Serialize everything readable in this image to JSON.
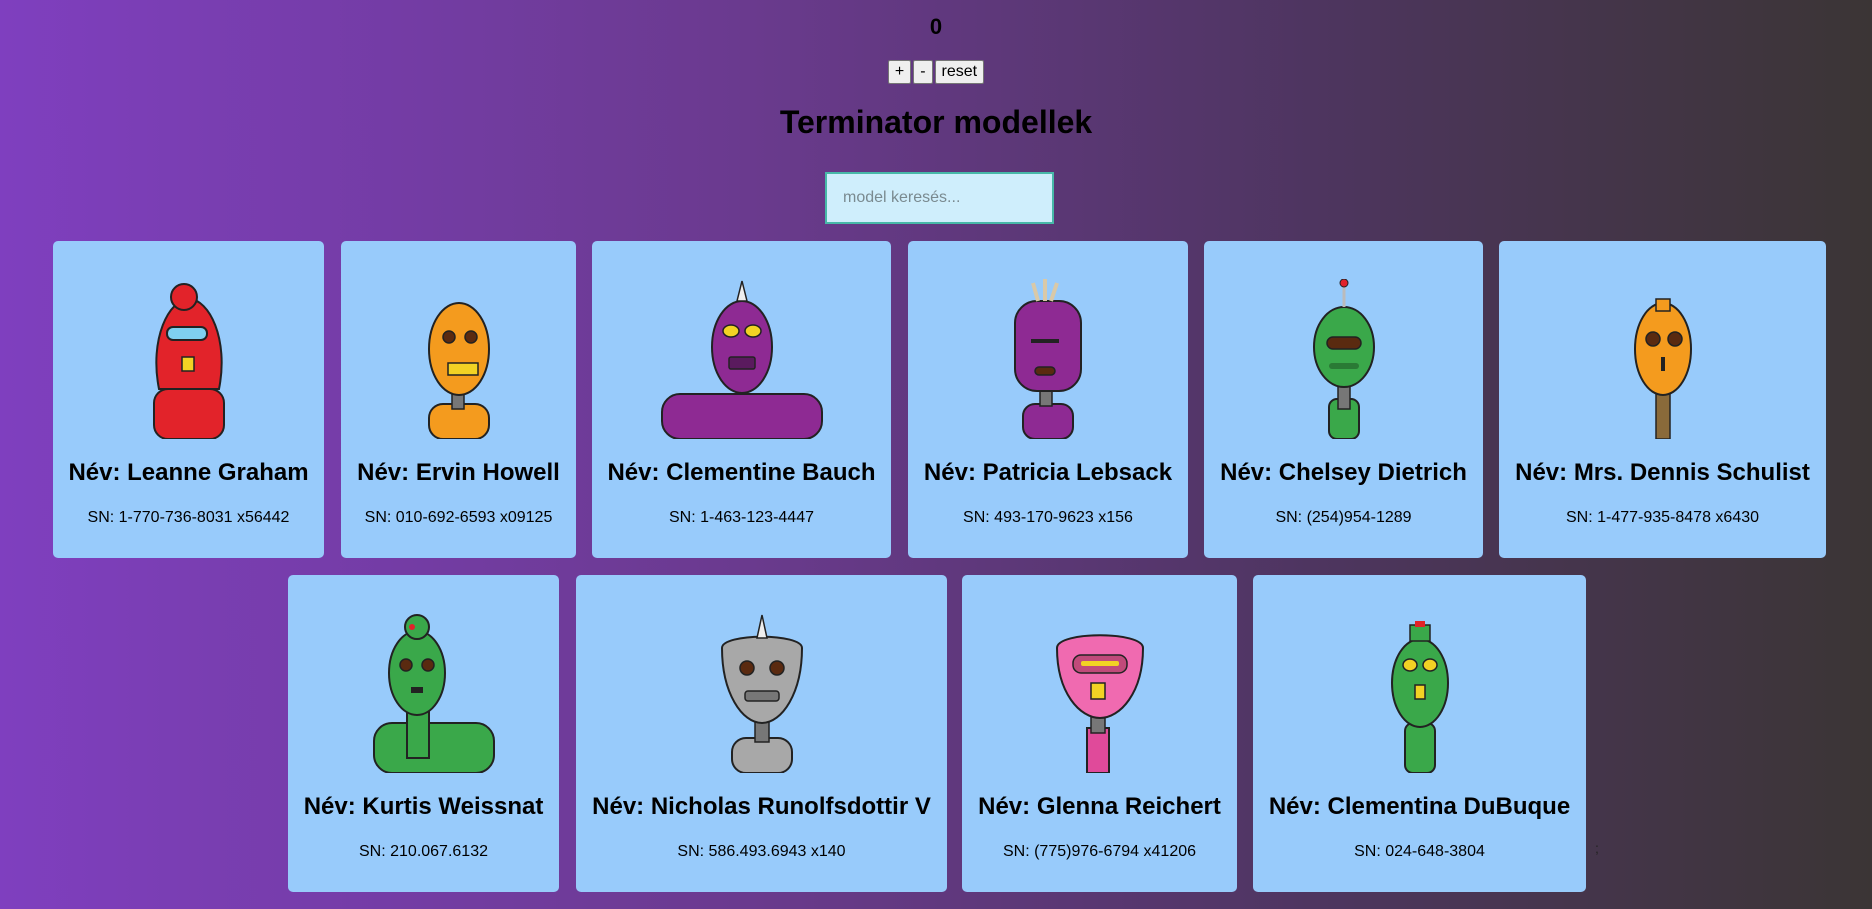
{
  "counter": {
    "value": "0"
  },
  "controls": {
    "plus_label": "+",
    "minus_label": "-",
    "reset_label": "reset"
  },
  "page": {
    "title": "Terminator modellek"
  },
  "search": {
    "placeholder": "model keresés...",
    "value": ""
  },
  "robots": [
    {
      "name": "Név: Leanne Graham",
      "sn": "SN: 1-770-736-8031 x56442",
      "color": "#e2232a"
    },
    {
      "name": "Név: Ervin Howell",
      "sn": "SN: 010-692-6593 x09125",
      "color": "#f49b1e"
    },
    {
      "name": "Név: Clementine Bauch",
      "sn": "SN: 1-463-123-4447",
      "color": "#8e2a93"
    },
    {
      "name": "Név: Patricia Lebsack",
      "sn": "SN: 493-170-9623 x156",
      "color": "#8e2a93"
    },
    {
      "name": "Név: Chelsey Dietrich",
      "sn": "SN: (254)954-1289",
      "color": "#3aa84a"
    },
    {
      "name": "Név: Mrs. Dennis Schulist",
      "sn": "SN: 1-477-935-8478 x6430",
      "color": "#f49b1e"
    },
    {
      "name": "Név: Kurtis Weissnat",
      "sn": "SN: 210.067.6132",
      "color": "#3aa84a"
    },
    {
      "name": "Név: Nicholas Runolfsdottir V",
      "sn": "SN: 586.493.6943 x140",
      "color": "#a8a8a8"
    },
    {
      "name": "Név: Glenna Reichert",
      "sn": "SN: (775)976-6794 x41206",
      "color": "#f06ab0"
    },
    {
      "name": "Név: Clementina DuBuque",
      "sn": "SN: 024-648-3804",
      "color": "#3aa84a"
    }
  ],
  "stray_text": ";"
}
